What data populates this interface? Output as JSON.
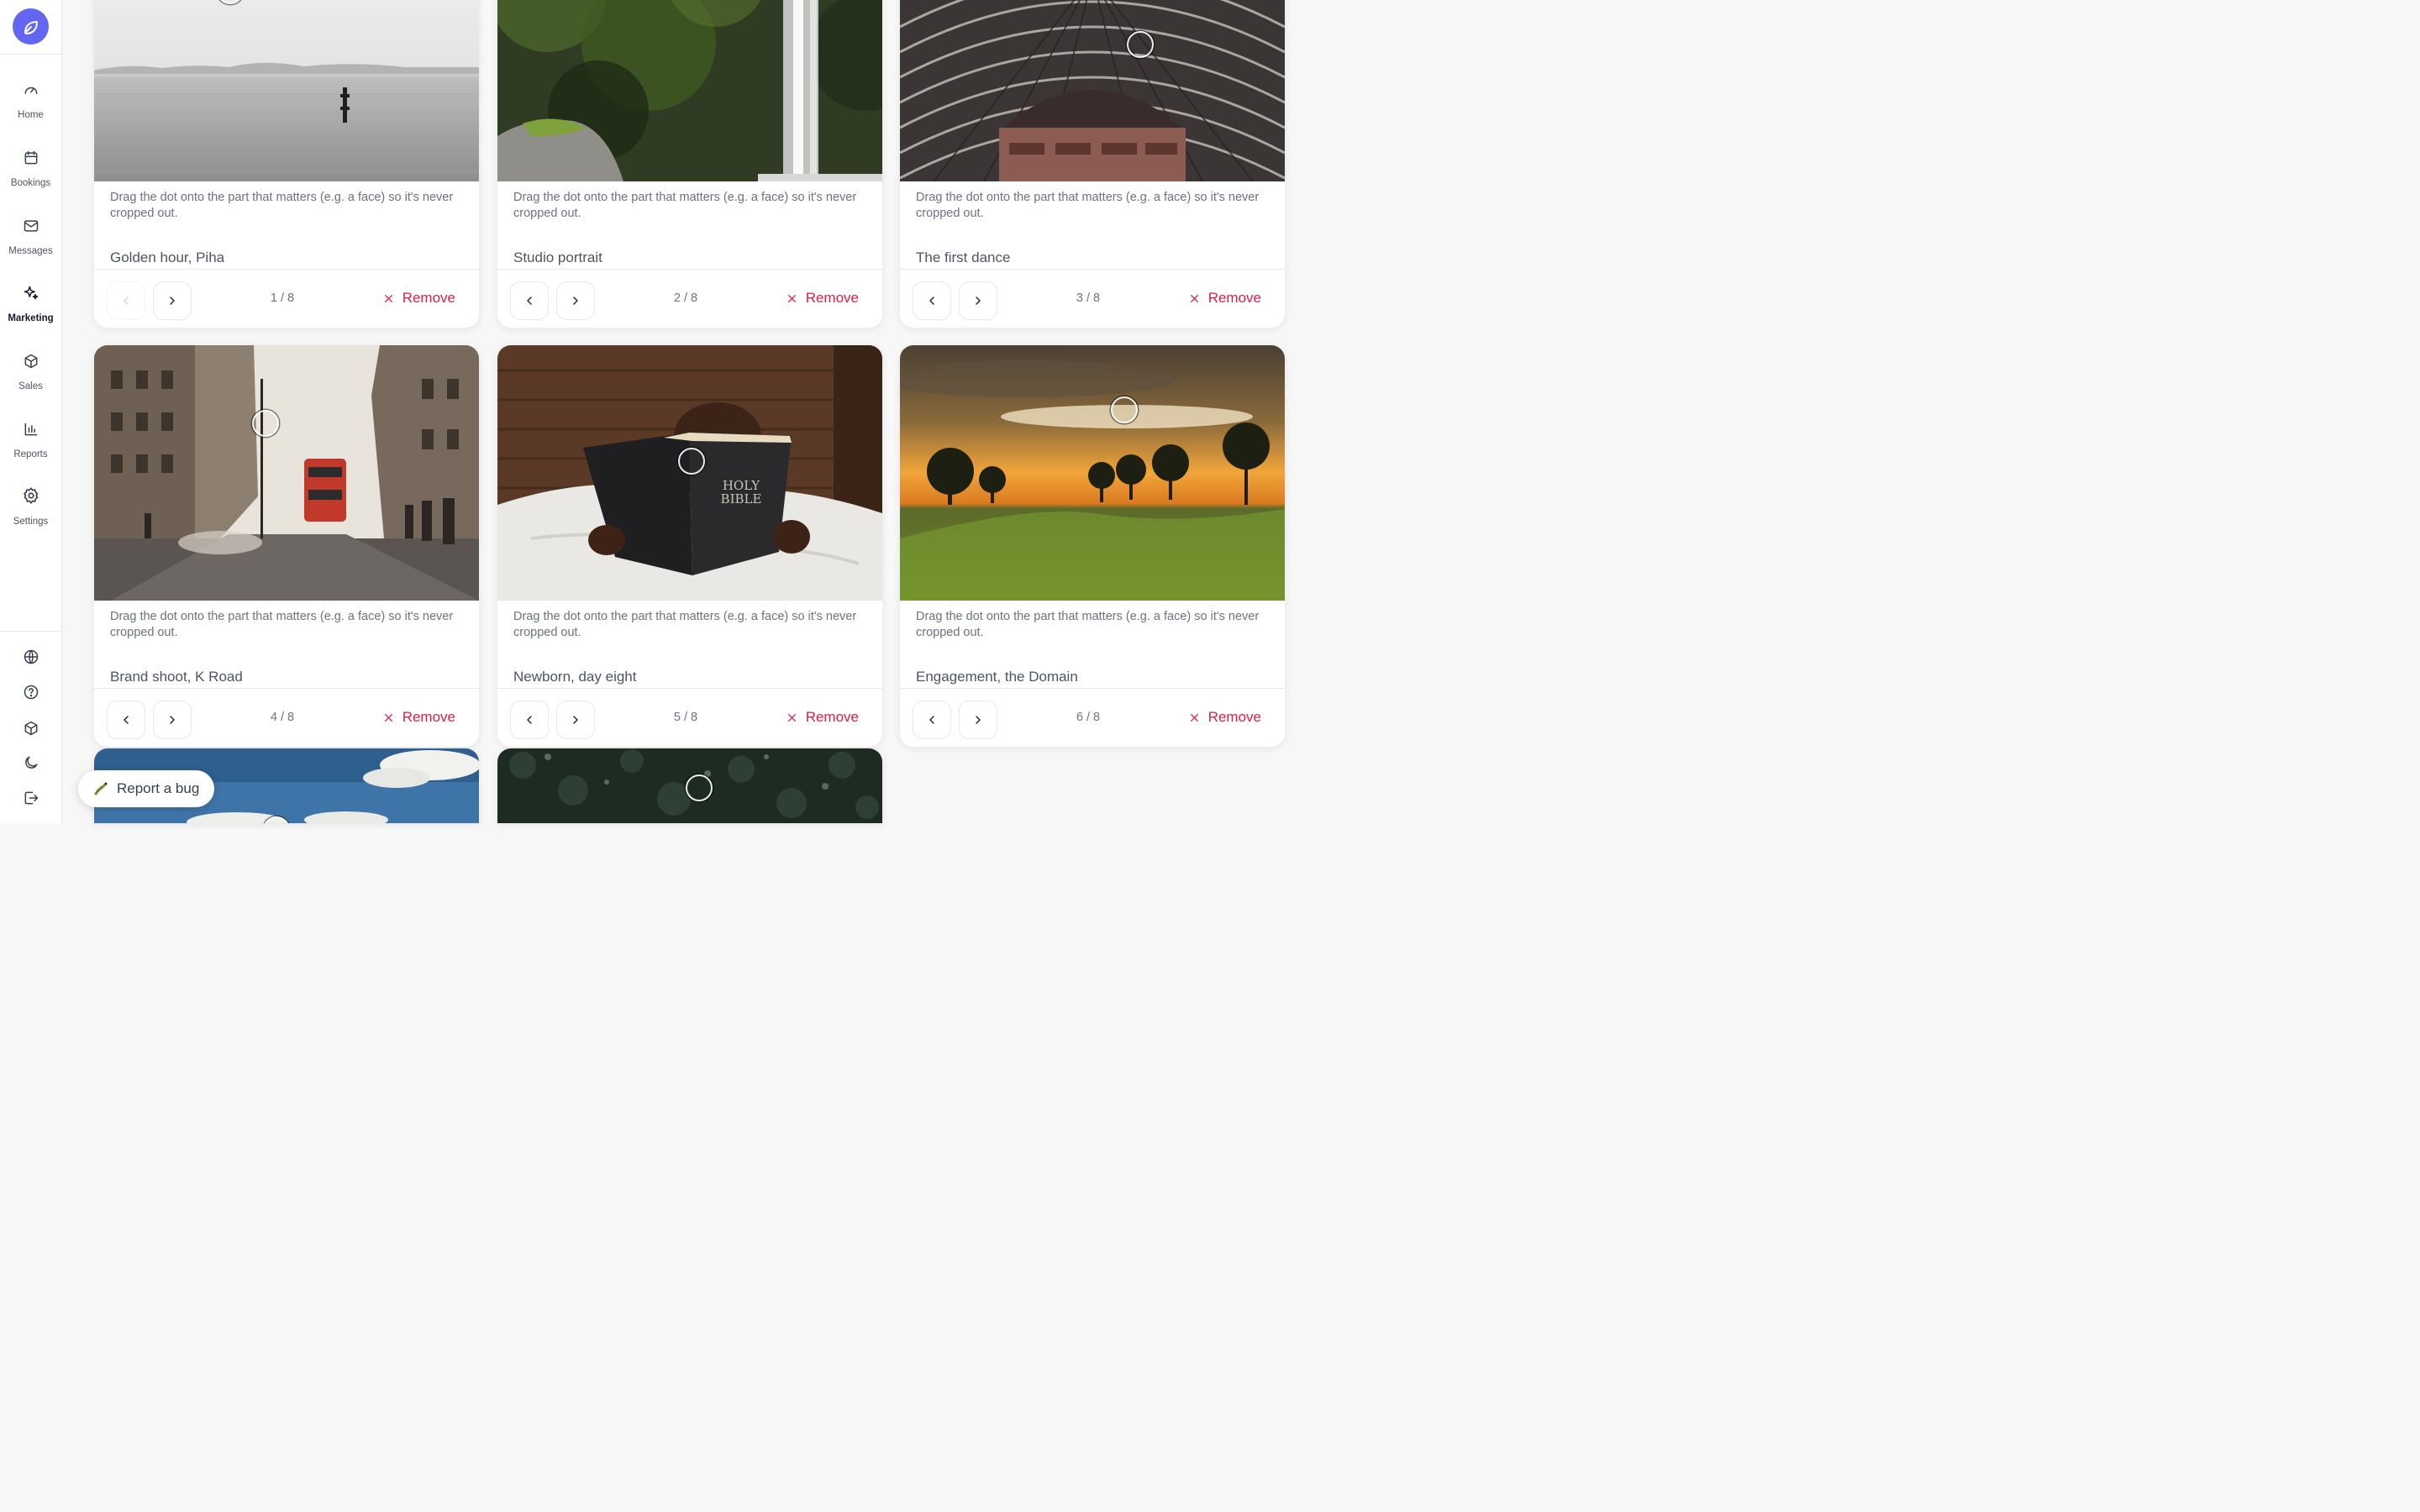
{
  "sidebar": {
    "nav": [
      {
        "label": "Home",
        "icon": "gauge-icon"
      },
      {
        "label": "Bookings",
        "icon": "calendar-icon"
      },
      {
        "label": "Messages",
        "icon": "mail-icon"
      },
      {
        "label": "Marketing",
        "icon": "sparkles-icon",
        "active": true
      },
      {
        "label": "Sales",
        "icon": "box-icon"
      },
      {
        "label": "Reports",
        "icon": "bar-chart-icon"
      },
      {
        "label": "Settings",
        "icon": "gear-icon"
      }
    ],
    "utilities": [
      "globe-icon",
      "help-circle-icon",
      "package-icon",
      "moon-icon",
      "logout-icon"
    ]
  },
  "gallery": {
    "hint": "Drag the dot onto the part that matters (e.g. a face) so it's never cropped out.",
    "remove_label": "Remove",
    "cards": [
      {
        "caption": "Golden hour, Piha",
        "counter": "1 / 8"
      },
      {
        "caption": "Studio portrait",
        "counter": "2 / 8"
      },
      {
        "caption": "The first dance",
        "counter": "3 / 8"
      },
      {
        "caption": "Brand shoot, K Road",
        "counter": "4 / 8"
      },
      {
        "caption": "Newborn, day eight",
        "counter": "5 / 8"
      },
      {
        "caption": "Engagement, the Domain",
        "counter": "6 / 8"
      }
    ]
  },
  "bug_report": {
    "label": "Report a bug",
    "icon": "bug-icon"
  },
  "colors": {
    "accent": "#6366f1",
    "danger": "#e11d48"
  }
}
